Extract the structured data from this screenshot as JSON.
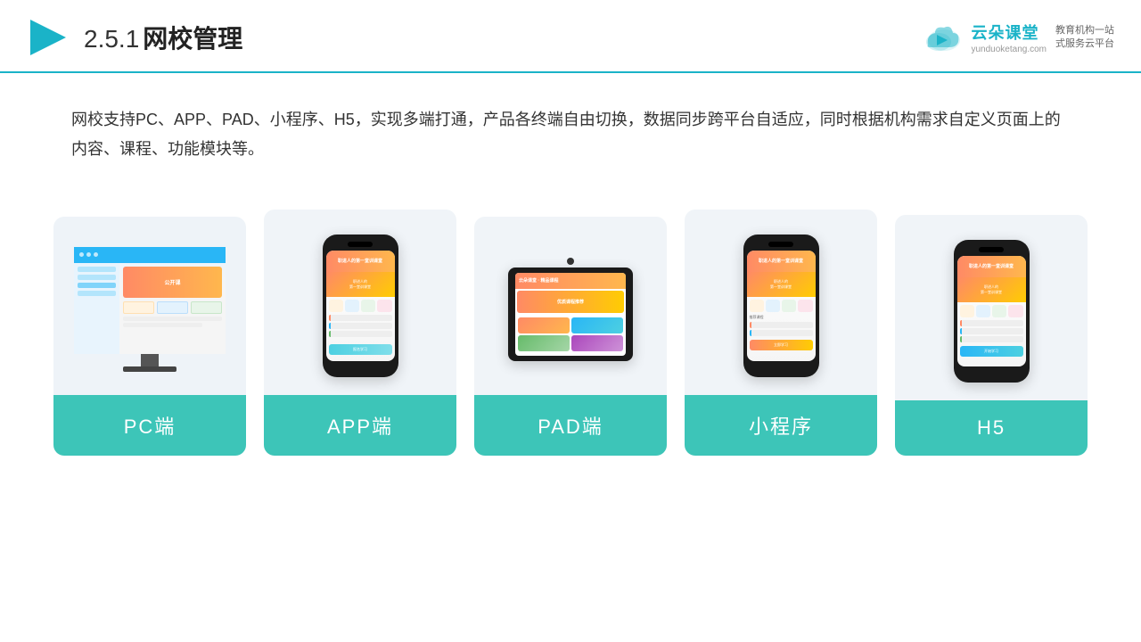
{
  "header": {
    "section_number": "2.5.1",
    "title": "网校管理",
    "logo_name": "云朵课堂",
    "logo_url": "yunduoketang.com",
    "logo_tagline": "教育机构一站\n式服务云平台"
  },
  "description": {
    "text": "网校支持PC、APP、PAD、小程序、H5，实现多端打通，产品各终端自由切换，数据同步跨平台自适应，同时根据机构需求自定义页面上的内容、课程、功能模块等。"
  },
  "cards": [
    {
      "id": "pc",
      "label": "PC端"
    },
    {
      "id": "app",
      "label": "APP端"
    },
    {
      "id": "pad",
      "label": "PAD端"
    },
    {
      "id": "miniapp",
      "label": "小程序"
    },
    {
      "id": "h5",
      "label": "H5"
    }
  ],
  "colors": {
    "accent": "#3dc5b8",
    "border": "#1ab3c8",
    "title": "#222222",
    "body_text": "#333333",
    "card_bg": "#f0f4f8"
  }
}
